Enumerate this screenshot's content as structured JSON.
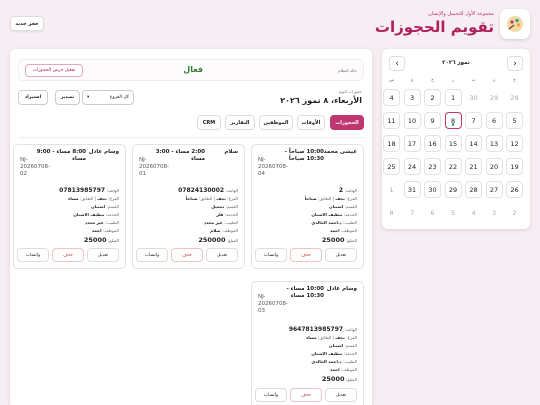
{
  "header": {
    "subtitle": "مجموعة الأول للتجميل والإنسان",
    "title": "تقويم الحجوزات",
    "new_button": "حجز جديد"
  },
  "calendar": {
    "month_label": "تموز ٢٠٢٦",
    "prev": "‹",
    "next": "›",
    "weekdays": [
      "ح",
      "ن",
      "ث",
      "ر",
      "خ",
      "ج",
      "س"
    ],
    "weeks": [
      [
        {
          "d": "28",
          "o": true
        },
        {
          "d": "29",
          "o": true
        },
        {
          "d": "30",
          "o": true
        },
        {
          "d": "1"
        },
        {
          "d": "2"
        },
        {
          "d": "3"
        },
        {
          "d": "4"
        }
      ],
      [
        {
          "d": "5"
        },
        {
          "d": "6"
        },
        {
          "d": "7"
        },
        {
          "d": "8",
          "sel": true,
          "dot": true
        },
        {
          "d": "9"
        },
        {
          "d": "10"
        },
        {
          "d": "11"
        }
      ],
      [
        {
          "d": "12"
        },
        {
          "d": "13"
        },
        {
          "d": "14"
        },
        {
          "d": "15"
        },
        {
          "d": "16"
        },
        {
          "d": "17"
        },
        {
          "d": "18"
        }
      ],
      [
        {
          "d": "19"
        },
        {
          "d": "20"
        },
        {
          "d": "21"
        },
        {
          "d": "22"
        },
        {
          "d": "23"
        },
        {
          "d": "24"
        },
        {
          "d": "25"
        }
      ],
      [
        {
          "d": "26"
        },
        {
          "d": "27"
        },
        {
          "d": "28"
        },
        {
          "d": "29"
        },
        {
          "d": "30"
        },
        {
          "d": "31"
        },
        {
          "d": "1",
          "o": true
        }
      ],
      [
        {
          "d": "2",
          "o": true
        },
        {
          "d": "3",
          "o": true
        },
        {
          "d": "4",
          "o": true
        },
        {
          "d": "5",
          "o": true
        },
        {
          "d": "6",
          "o": true
        },
        {
          "d": "7",
          "o": true
        },
        {
          "d": "8",
          "o": true
        }
      ]
    ]
  },
  "status": {
    "label": "حالة النظام",
    "value": "فعال",
    "button": "تفعيل جرس الحجوزات"
  },
  "bookings": {
    "label": "حجوزات اليوم",
    "date": "الأربعاء، ٨ تموز ٢٠٢٦",
    "branch_select": "كل الفروع",
    "export_button": "تصدير",
    "import_button": "استيراد"
  },
  "tabs": [
    "الحجوزات",
    "الأوقات",
    "الموظفين",
    "التقارير",
    "CRM"
  ],
  "labels": {
    "phone": "الهاتف:",
    "branch": "الفرع:",
    "floor": "الطابق:",
    "section": "القسم:",
    "service": "الخدمة:",
    "doctor": "الطبيب:",
    "employee": "الموظف:",
    "amount": "المبلغ:",
    "edit": "تعديل",
    "delete": "حذف",
    "whatsapp": "واتساب"
  },
  "cards": [
    {
      "name": "عيشى محمد",
      "time": "10:00 صباحاً - 10:30 صباحاً",
      "id": "NJ-20260708-04",
      "phone": "2",
      "branch": "نجف",
      "floor": "صباحاً",
      "section": "استنان",
      "service": "تنظيف الاسنان",
      "doctor": "د.احمد الخالدي",
      "employee": "احمد",
      "amount": "25000"
    },
    {
      "name": "سلام",
      "time": "2:00 مساء - 3:00 مساء",
      "id": "NJ-20260708-01",
      "phone": "07824130002",
      "branch": "نجف",
      "floor": "صباحاً",
      "section": "تجميل",
      "service": "فلر",
      "doctor": "غير محدد",
      "employee": "سلام",
      "amount": "250000"
    },
    {
      "name": "وسام عادل",
      "time": "8:00 مساء - 9:00 مساء",
      "id": "NJ-20260708-02",
      "phone": "07813985797",
      "branch": "نجف",
      "floor": "مساء",
      "section": "استنان",
      "service": "تنظيف الاسنان",
      "doctor": "غير محدد",
      "employee": "احمد",
      "amount": "25000"
    },
    {
      "name": "وسام عادل",
      "time": "10:00 مساء - 10:30 مساء",
      "id": "NJ-20260708-03",
      "phone": "9647813985797",
      "branch": "نجف",
      "floor": "مساء",
      "section": "استنان",
      "service": "تنظيف الاسنان",
      "doctor": "د.احمد الخالدي",
      "employee": "احمد",
      "amount": "25000"
    }
  ],
  "colors": {
    "accent": "#c0366f",
    "active_status": "#2e7d32",
    "dot": "#2a9d8f"
  }
}
